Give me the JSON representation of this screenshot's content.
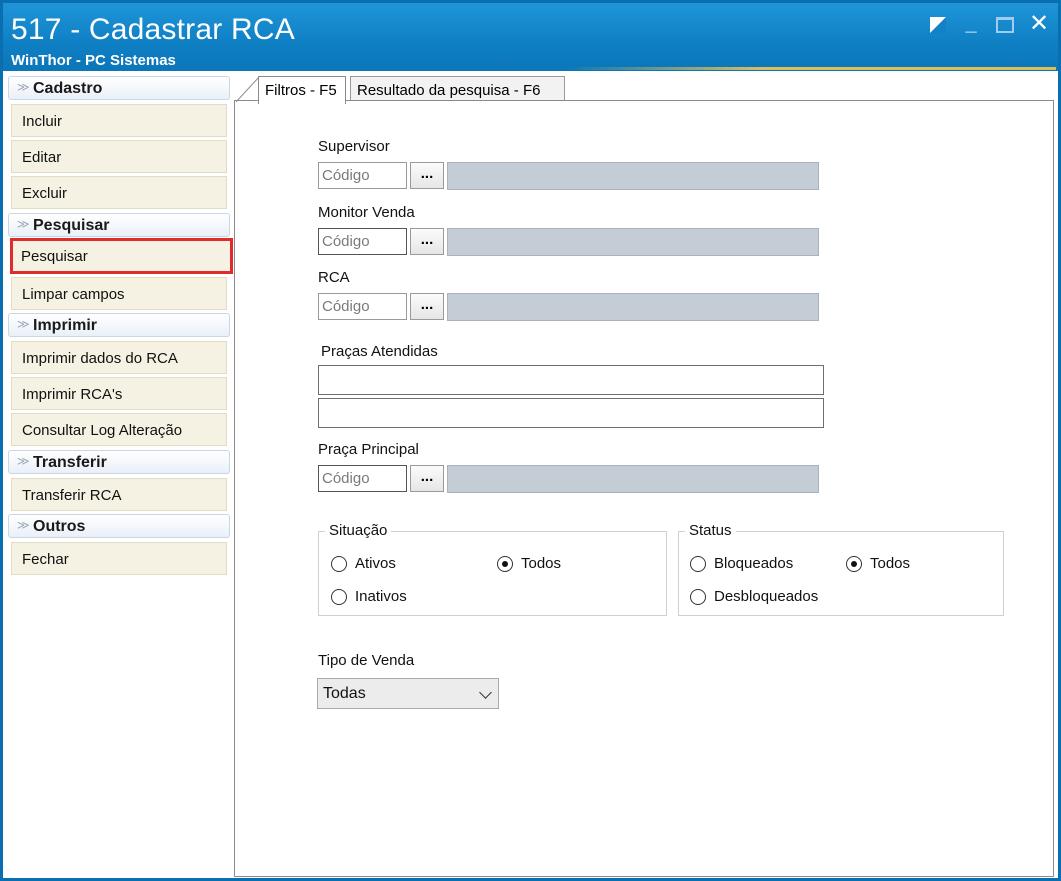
{
  "window": {
    "title": "517 - Cadastrar RCA",
    "subtitle": "WinThor - PC Sistemas"
  },
  "sidebar": {
    "groups": [
      {
        "label": "Cadastro",
        "items": [
          "Incluir",
          "Editar",
          "Excluir"
        ]
      },
      {
        "label": "Pesquisar",
        "items": [
          "Pesquisar",
          "Limpar campos"
        ]
      },
      {
        "label": "Imprimir",
        "items": [
          "Imprimir dados do RCA",
          "Imprimir RCA's",
          "Consultar Log Alteração"
        ]
      },
      {
        "label": "Transferir",
        "items": [
          "Transferir RCA"
        ]
      },
      {
        "label": "Outros",
        "items": [
          "Fechar"
        ]
      }
    ],
    "highlighted_item": "Pesquisar"
  },
  "tabs": [
    {
      "label": "Filtros - F5",
      "active": true
    },
    {
      "label": "Resultado da pesquisa - F6",
      "active": false
    }
  ],
  "filters": {
    "supervisor": {
      "label": "Supervisor",
      "placeholder": "Código",
      "button": "..."
    },
    "monitor": {
      "label": "Monitor Venda",
      "placeholder": "Código",
      "button": "..."
    },
    "rca": {
      "label": "RCA",
      "placeholder": "Código",
      "button": "..."
    },
    "pracas_atendidas": {
      "label": "Praças Atendidas"
    },
    "praca_principal": {
      "label": "Praça Principal",
      "placeholder": "Código",
      "button": "..."
    },
    "situacao": {
      "title": "Situação",
      "options": [
        {
          "label": "Ativos",
          "checked": false
        },
        {
          "label": "Todos",
          "checked": true
        },
        {
          "label": "Inativos",
          "checked": false
        }
      ]
    },
    "status": {
      "title": "Status",
      "options": [
        {
          "label": "Bloqueados",
          "checked": false
        },
        {
          "label": "Todos",
          "checked": true
        },
        {
          "label": "Desbloqueados",
          "checked": false
        }
      ]
    },
    "tipo_venda": {
      "label": "Tipo de Venda",
      "selected": "Todas"
    }
  },
  "colors": {
    "titlebar": "#1281c5",
    "highlight_border": "#e02b2b",
    "menu_item_bg": "#f6f2e3",
    "desc_box": "#c4ccd6"
  }
}
